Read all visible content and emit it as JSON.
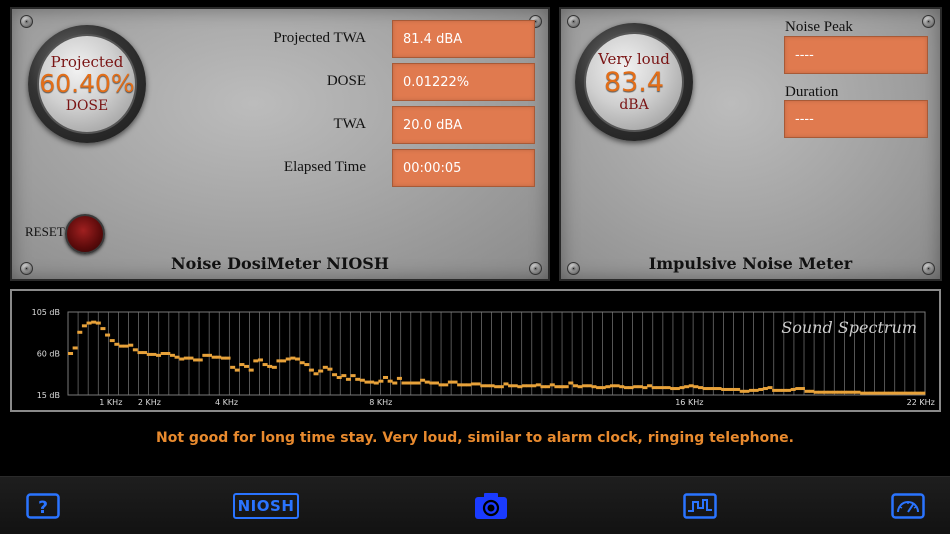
{
  "dosimeter": {
    "title": "Noise DosiMeter NIOSH",
    "gauge": {
      "top": "Projected",
      "value": "60.40%",
      "bottom": "DOSE"
    },
    "fields": [
      {
        "label": "Projected TWA",
        "value": "81.4 dBA"
      },
      {
        "label": "DOSE",
        "value": "0.01222%"
      },
      {
        "label": "TWA",
        "value": "20.0 dBA"
      },
      {
        "label": "Elapsed Time",
        "value": "00:00:05"
      }
    ],
    "reset_label": "RESET"
  },
  "impulsive": {
    "title": "Impulsive Noise Meter",
    "gauge": {
      "top": "Very loud",
      "value": "83.4",
      "bottom": "dBA"
    },
    "fields": [
      {
        "label": "Noise Peak",
        "value": "----"
      },
      {
        "label": "Duration",
        "value": "----"
      }
    ]
  },
  "spectrum": {
    "watermark": "Sound Spectrum",
    "y_labels": [
      "105 dB",
      "60 dB",
      "15 dB"
    ],
    "x_labels": [
      "1 KHz",
      "2 KHz",
      "4 KHz",
      "8 KHz",
      "16 KHz",
      "22 KHz"
    ],
    "ylim": [
      15,
      105
    ],
    "levels": [
      60,
      66,
      83,
      90,
      93,
      94,
      93,
      87,
      80,
      74,
      70,
      68,
      68,
      69,
      64,
      61,
      61,
      59,
      59,
      58,
      60,
      60,
      58,
      56,
      54,
      55,
      55,
      53,
      53,
      58,
      58,
      56,
      56,
      55,
      55,
      45,
      42,
      48,
      46,
      42,
      52,
      53,
      48,
      46,
      45,
      52,
      52,
      54,
      55,
      54,
      50,
      48,
      42,
      38,
      41,
      45,
      43,
      37,
      34,
      36,
      32,
      36,
      32,
      31,
      29,
      29,
      28,
      30,
      34,
      30,
      28,
      33,
      28,
      28,
      28,
      28,
      31,
      29,
      28,
      28,
      26,
      26,
      29,
      29,
      26,
      26,
      26,
      27,
      27,
      25,
      25,
      25,
      24,
      24,
      27,
      25,
      25,
      24,
      25,
      25,
      25,
      26,
      24,
      24,
      26,
      24,
      24,
      24,
      28,
      25,
      24,
      25,
      25,
      24,
      23,
      23,
      24,
      25,
      25,
      24,
      23,
      23,
      24,
      24,
      23,
      25,
      23,
      23,
      23,
      23,
      22,
      22,
      23,
      24,
      25,
      24,
      23,
      22,
      22,
      22,
      22,
      21,
      21,
      21,
      21,
      19,
      19,
      20,
      20,
      21,
      22,
      23,
      20,
      20,
      20,
      20,
      21,
      22,
      22,
      19,
      19,
      18,
      18,
      18,
      18,
      18,
      18,
      18,
      18,
      18,
      18,
      17,
      17,
      17,
      17,
      17,
      17,
      17,
      17,
      17,
      17,
      17,
      17,
      17,
      17
    ],
    "bar_color": "#e8a23a",
    "grid_color": "#7a7a7a"
  },
  "message": "Not good for long time stay. Very loud, similar to alarm clock, ringing telephone.",
  "tabs": [
    {
      "name": "help",
      "icon": "question-icon"
    },
    {
      "name": "niosh",
      "label": "NIOSH"
    },
    {
      "name": "camera",
      "icon": "camera-icon"
    },
    {
      "name": "spectrum",
      "icon": "waveform-icon"
    },
    {
      "name": "meter",
      "icon": "gauge-icon"
    }
  ],
  "colors": {
    "accent": "#2a74ff",
    "active": "#1a3bff",
    "value_bg": "#e07a4f",
    "message": "#e88a2e"
  }
}
